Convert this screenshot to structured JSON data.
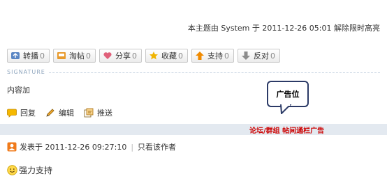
{
  "thread_notice": "本主题由 System 于 2011-12-26 05:01 解除限时高亮",
  "action_buttons": [
    {
      "label": "转播",
      "count": "0",
      "icon": "broadcast-icon",
      "color": "#5a86c4"
    },
    {
      "label": "淘帖",
      "count": "0",
      "icon": "collect-tray-icon",
      "color": "#e89a2c"
    },
    {
      "label": "分享",
      "count": "0",
      "icon": "heart-share-icon",
      "color": "#e0607a"
    },
    {
      "label": "收藏",
      "count": "0",
      "icon": "star-icon",
      "color": "#f0b400"
    },
    {
      "label": "支持",
      "count": "0",
      "icon": "thumb-up-arrow-icon",
      "color": "#f08a00"
    },
    {
      "label": "反对",
      "count": "0",
      "icon": "thumb-down-arrow-icon",
      "color": "#8c8c8c"
    }
  ],
  "signature": {
    "label": "SIGNATURE",
    "content": "内容加"
  },
  "post_tools": [
    {
      "label": "回复",
      "icon": "reply-bubble-icon"
    },
    {
      "label": "编辑",
      "icon": "edit-pencil-icon"
    },
    {
      "label": "推送",
      "icon": "push-icon"
    }
  ],
  "ad_bubble": "广告位",
  "ad_link": "论坛/群组 帖间通栏广告",
  "next_post": {
    "posted_label": "发表于",
    "datetime": "2011-12-26 09:27:10",
    "only_author": "只看该作者",
    "separator": "|",
    "content": "强力支持"
  }
}
